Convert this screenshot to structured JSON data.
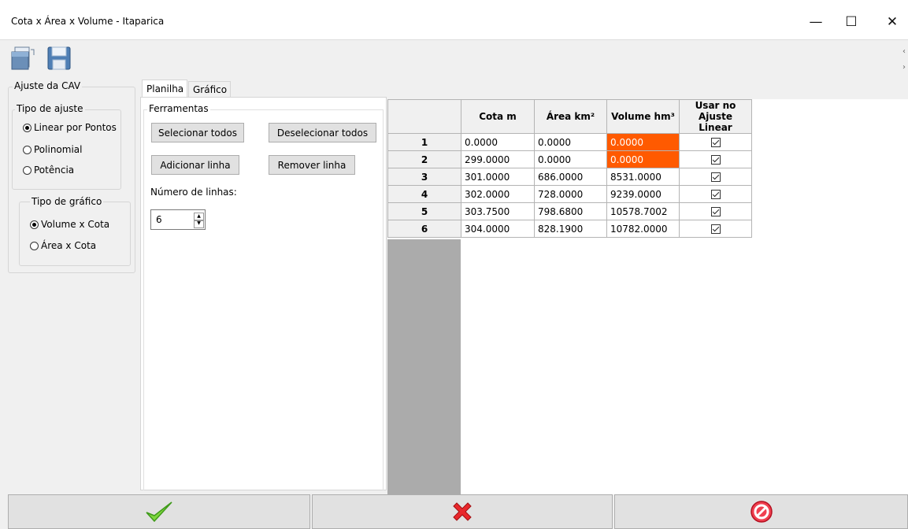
{
  "window": {
    "title": "Cota x Área x Volume - Itaparica",
    "minimize_glyph": "—",
    "maximize_glyph": "☐",
    "close_glyph": "✕"
  },
  "toolbar": {
    "icons": [
      "open-file-icon",
      "save-icon"
    ]
  },
  "left_panel": {
    "group_title": "Ajuste da CAV",
    "ajuste": {
      "title": "Tipo de ajuste",
      "options": [
        "Linear por Pontos",
        "Polinomial",
        "Potência"
      ],
      "selected": 0
    },
    "grafico": {
      "title": "Tipo de gráfico",
      "options": [
        "Volume x Cota",
        "Área x Cota"
      ],
      "selected": 0
    }
  },
  "tabs": [
    "Planilha",
    "Gráfico"
  ],
  "active_tab": 0,
  "tools": {
    "title": "Ferramentas",
    "select_all": "Selecionar todos",
    "deselect_all": "Deselecionar todos",
    "add_row": "Adicionar linha",
    "remove_row": "Remover linha",
    "row_count_label": "Número de linhas:",
    "row_count_value": "6"
  },
  "table": {
    "headers": {
      "cota": "Cota m",
      "area": "Área km²",
      "volume": "Volume hm³",
      "usar_line1": "Usar no",
      "usar_line2": "Ajuste Linear"
    },
    "rows": [
      {
        "n": "1",
        "cota": "0.0000",
        "area": "0.0000",
        "volume": "0.0000",
        "highlight": true,
        "checked": true
      },
      {
        "n": "2",
        "cota": "299.0000",
        "area": "0.0000",
        "volume": "0.0000",
        "highlight": true,
        "checked": true
      },
      {
        "n": "3",
        "cota": "301.0000",
        "area": "686.0000",
        "volume": "8531.0000",
        "highlight": false,
        "checked": true
      },
      {
        "n": "4",
        "cota": "302.0000",
        "area": "728.0000",
        "volume": "9239.0000",
        "highlight": false,
        "checked": true
      },
      {
        "n": "5",
        "cota": "303.7500",
        "area": "798.6800",
        "volume": "10578.7002",
        "highlight": false,
        "checked": true
      },
      {
        "n": "6",
        "cota": "304.0000",
        "area": "828.1900",
        "volume": "10782.0000",
        "highlight": false,
        "checked": true
      }
    ],
    "highlight_color": "#ff5a00"
  },
  "bottom_buttons": [
    "ok-check-icon",
    "cancel-x-icon",
    "stop-icon"
  ]
}
